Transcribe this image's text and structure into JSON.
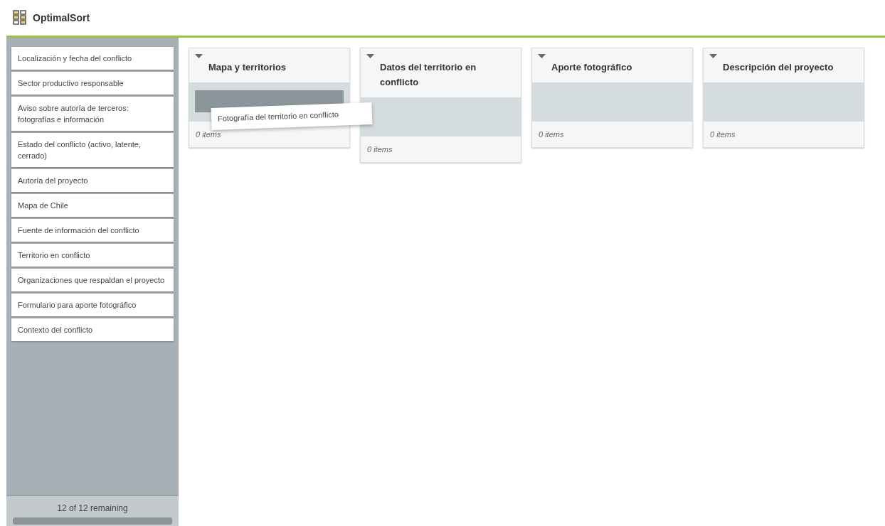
{
  "header": {
    "app_name": "OptimalSort"
  },
  "cards": [
    {
      "label": "Localización y fecha del conflicto"
    },
    {
      "label": "Sector productivo responsable"
    },
    {
      "label": "Aviso sobre autoría de terceros: fotografías e información"
    },
    {
      "label": "Estado del conflicto (activo, latente, cerrado)"
    },
    {
      "label": "Autoría del proyecto"
    },
    {
      "label": "Mapa de Chile"
    },
    {
      "label": "Fuente de información del conflicto"
    },
    {
      "label": "Territorio en conflicto"
    },
    {
      "label": "Organizaciones que respaldan el proyecto"
    },
    {
      "label": "Formulario para aporte fotográfico"
    },
    {
      "label": "Contexto del conflicto"
    }
  ],
  "remaining": "12 of 12 remaining",
  "categories": [
    {
      "title": "Mapa y territorios",
      "count": "0 items",
      "drop_placeholder": true
    },
    {
      "title": "Datos del territorio en conflicto",
      "count": "0 items",
      "drop_placeholder": false
    },
    {
      "title": "Aporte fotográfico",
      "count": "0 items",
      "drop_placeholder": false
    },
    {
      "title": "Descripción del proyecto",
      "count": "0 items",
      "drop_placeholder": false
    }
  ],
  "dragged_card": {
    "label": "Fotografía del territorio en conflicto"
  }
}
